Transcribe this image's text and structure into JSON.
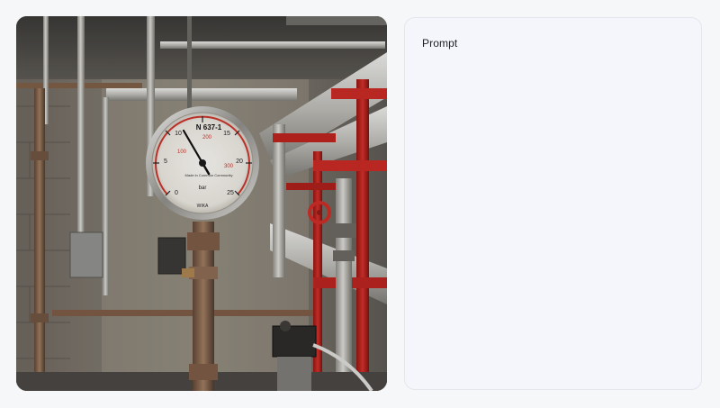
{
  "prompt_panel": {
    "title": "Prompt",
    "body": ""
  },
  "image": {
    "subject": "pressure-gauge-in-pipe-room",
    "gauge": {
      "model_label": "N 637-1",
      "caption": "Made in Common Community",
      "unit": "bar",
      "brand": "WIKA",
      "outer_ticks": [
        "0",
        "5",
        "10",
        "15",
        "20",
        "25"
      ],
      "inner_ticks": [
        "100",
        "200",
        "300"
      ]
    }
  }
}
